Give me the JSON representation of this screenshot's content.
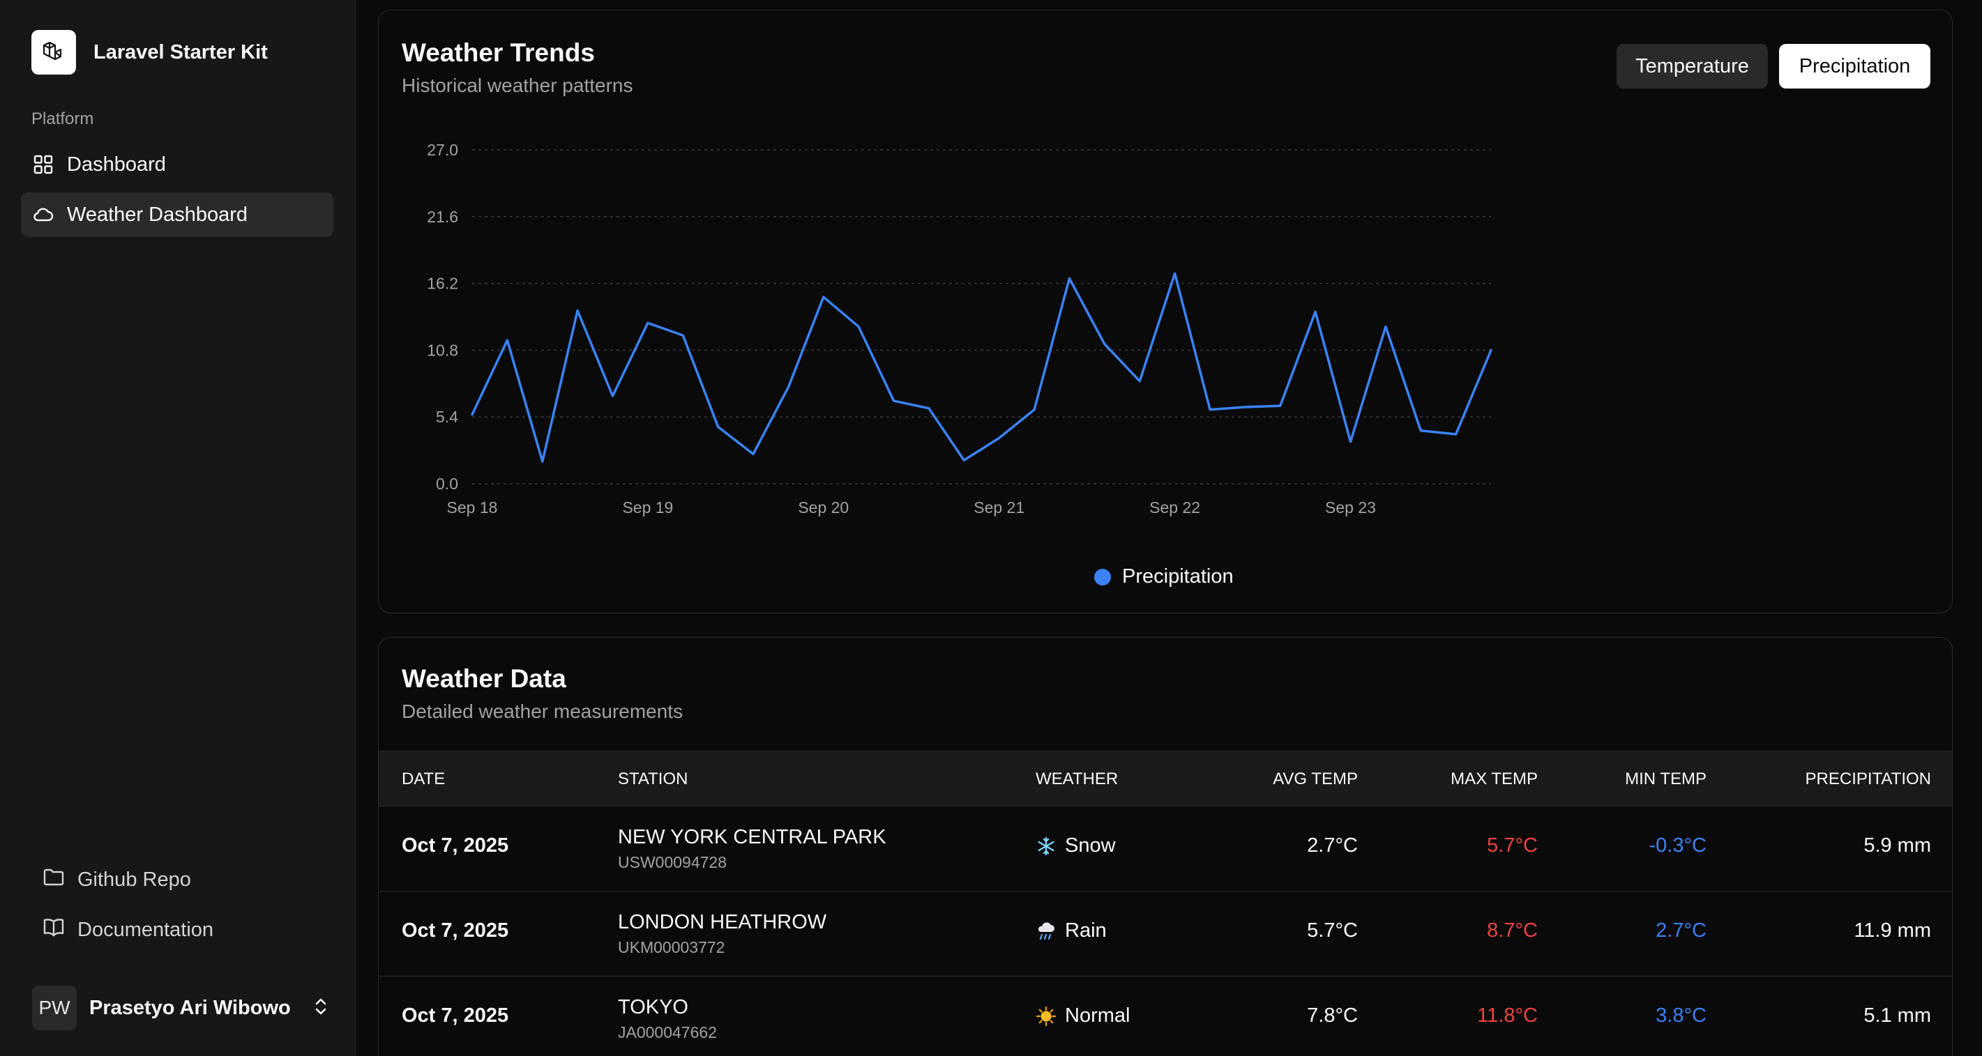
{
  "sidebar": {
    "brand": "Laravel Starter Kit",
    "section": "Platform",
    "nav": [
      {
        "label": "Dashboard",
        "icon": "grid-icon"
      },
      {
        "label": "Weather Dashboard",
        "icon": "cloud-icon",
        "active": true
      }
    ],
    "footer": [
      {
        "label": "Github Repo",
        "icon": "folder-icon"
      },
      {
        "label": "Documentation",
        "icon": "book-icon"
      }
    ],
    "user": {
      "initials": "PW",
      "name": "Prasetyo Ari Wibowo"
    }
  },
  "trends": {
    "title": "Weather Trends",
    "subtitle": "Historical weather patterns",
    "toggle_temperature": "Temperature",
    "toggle_precipitation": "Precipitation",
    "selected": "Precipitation"
  },
  "chart_data": {
    "type": "line",
    "y_ticks": [
      "0.0",
      "5.4",
      "10.8",
      "16.2",
      "21.6",
      "27.0"
    ],
    "ylim": [
      0,
      27
    ],
    "x_ticks": [
      {
        "label": "Sep 18",
        "index": 0
      },
      {
        "label": "Sep 19",
        "index": 5
      },
      {
        "label": "Sep 20",
        "index": 10
      },
      {
        "label": "Sep 21",
        "index": 15
      },
      {
        "label": "Sep 22",
        "index": 20
      },
      {
        "label": "Sep 23",
        "index": 25
      }
    ],
    "grid": true,
    "legend": "bottom-center",
    "series": [
      {
        "name": "Precipitation",
        "color": "#3b82f6",
        "values": [
          5.6,
          11.6,
          1.8,
          14.0,
          7.1,
          13.0,
          12.0,
          4.6,
          2.4,
          7.8,
          15.1,
          12.7,
          6.7,
          6.1,
          1.9,
          3.7,
          6.0,
          16.6,
          11.3,
          8.3,
          17.0,
          6.0,
          6.2,
          6.3,
          13.9,
          3.4,
          12.7,
          4.3,
          4.0,
          10.8
        ]
      }
    ]
  },
  "table": {
    "title": "Weather Data",
    "subtitle": "Detailed weather measurements",
    "columns": {
      "date": "DATE",
      "station": "STATION",
      "weather": "WEATHER",
      "avg": "AVG TEMP",
      "max": "MAX TEMP",
      "min": "MIN TEMP",
      "prec": "PRECIPITATION"
    },
    "rows": [
      {
        "date": "Oct 7, 2025",
        "station": "NEW YORK CENTRAL PARK",
        "station_id": "USW00094728",
        "weather": "Snow",
        "weather_icon": "snowflake-icon",
        "avg": "2.7°C",
        "max": "5.7°C",
        "min": "-0.3°C",
        "prec": "5.9 mm"
      },
      {
        "date": "Oct 7, 2025",
        "station": "LONDON HEATHROW",
        "station_id": "UKM00003772",
        "weather": "Rain",
        "weather_icon": "rain-cloud-icon",
        "avg": "5.7°C",
        "max": "8.7°C",
        "min": "2.7°C",
        "prec": "11.9 mm"
      },
      {
        "date": "Oct 7, 2025",
        "station": "TOKYO",
        "station_id": "JA000047662",
        "weather": "Normal",
        "weather_icon": "sun-icon",
        "avg": "7.8°C",
        "max": "11.8°C",
        "min": "3.8°C",
        "prec": "5.1 mm"
      }
    ]
  },
  "colors": {
    "accent_line": "#3b82f6",
    "max_temp": "#ef4444",
    "min_temp": "#3b82f6"
  }
}
